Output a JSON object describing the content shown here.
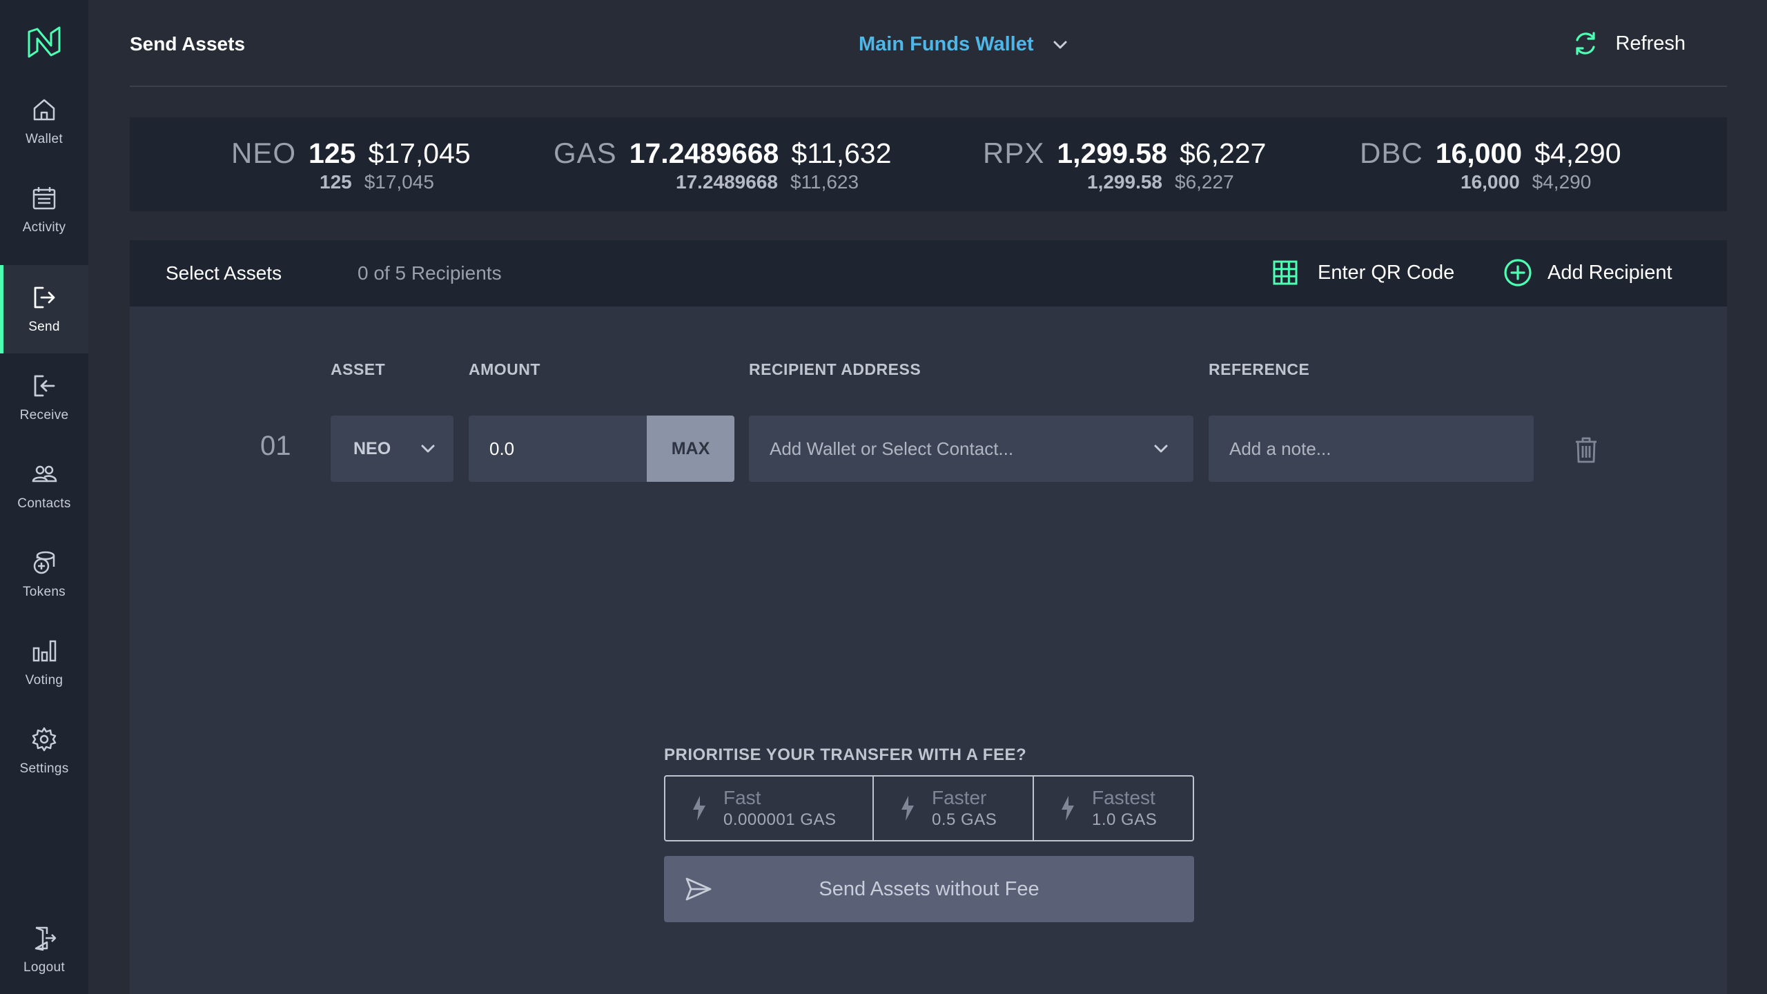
{
  "sidebar": {
    "items": [
      {
        "label": "Wallet",
        "icon": "home-icon"
      },
      {
        "label": "Activity",
        "icon": "calendar-icon"
      },
      {
        "label": "Send",
        "icon": "send-icon",
        "active": true
      },
      {
        "label": "Receive",
        "icon": "receive-icon"
      },
      {
        "label": "Contacts",
        "icon": "contacts-icon"
      },
      {
        "label": "Tokens",
        "icon": "tokens-icon"
      },
      {
        "label": "Voting",
        "icon": "voting-icon"
      },
      {
        "label": "Settings",
        "icon": "gear-icon"
      }
    ],
    "logout_label": "Logout"
  },
  "header": {
    "title": "Send Assets",
    "wallet_name": "Main Funds Wallet",
    "refresh_label": "Refresh"
  },
  "balances": [
    {
      "symbol": "NEO",
      "amount": "125",
      "usd": "$17,045",
      "amount_secondary": "125",
      "usd_secondary": "$17,045"
    },
    {
      "symbol": "GAS",
      "amount": "17.2489668",
      "usd": "$11,632",
      "amount_secondary": "17.2489668",
      "usd_secondary": "$11,623"
    },
    {
      "symbol": "RPX",
      "amount": "1,299.58",
      "usd": "$6,227",
      "amount_secondary": "1,299.58",
      "usd_secondary": "$6,227"
    },
    {
      "symbol": "DBC",
      "amount": "16,000",
      "usd": "$4,290",
      "amount_secondary": "16,000",
      "usd_secondary": "$4,290"
    }
  ],
  "panel": {
    "select_assets_label": "Select Assets",
    "recipient_count": "0 of 5 Recipients",
    "qr_label": "Enter QR Code",
    "add_recipient_label": "Add Recipient"
  },
  "columns": {
    "asset": "ASSET",
    "amount": "AMOUNT",
    "address": "RECIPIENT ADDRESS",
    "reference": "REFERENCE"
  },
  "row": {
    "index": "01",
    "asset": "NEO",
    "amount": "0.0",
    "max_label": "MAX",
    "address_placeholder": "Add Wallet or Select Contact...",
    "reference_placeholder": "Add a note..."
  },
  "fee": {
    "title": "PRIORITISE YOUR TRANSFER WITH A FEE?",
    "options": [
      {
        "name": "Fast",
        "value": "0.000001 GAS"
      },
      {
        "name": "Faster",
        "value": "0.5 GAS"
      },
      {
        "name": "Fastest",
        "value": "1.0 GAS"
      }
    ]
  },
  "send_label": "Send Assets without Fee",
  "colors": {
    "accent_green": "#4cffb3",
    "wallet_blue": "#4fb6e8",
    "sidebar_bg": "#1e2430",
    "main_bg": "#272c37"
  }
}
